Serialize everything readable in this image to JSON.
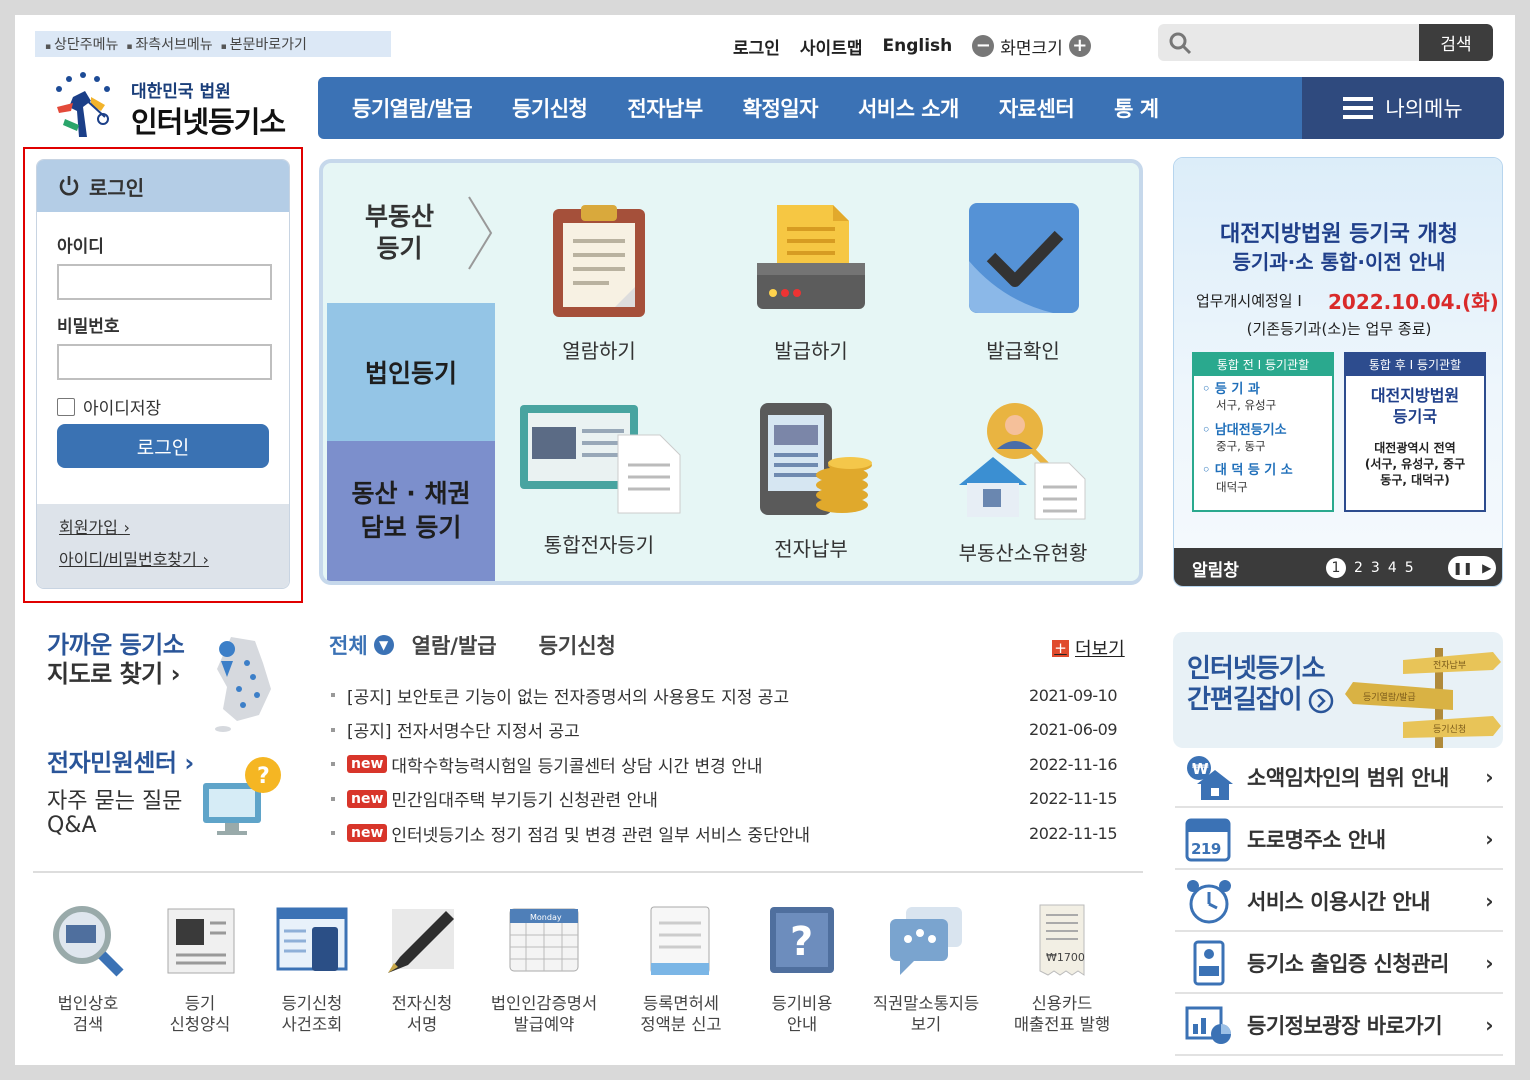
{
  "skip": {
    "items": [
      "상단주메뉴",
      "좌측서브메뉴",
      "본문바로가기"
    ]
  },
  "util": {
    "login": "로그인",
    "sitemap": "사이트맵",
    "english": "English",
    "zoom": "화면크기",
    "zoom_minus": "−",
    "zoom_plus": "+"
  },
  "search": {
    "placeholder": "",
    "button": "검색"
  },
  "logo": {
    "line1": "대한민국 법원",
    "line2": "인터넷등기소"
  },
  "nav": {
    "items": [
      "등기열람/발급",
      "등기신청",
      "전자납부",
      "확정일자",
      "서비스 소개",
      "자료센터",
      "통 계"
    ],
    "my_menu": "나의메뉴"
  },
  "login": {
    "title": "로그인",
    "id_label": "아이디",
    "pw_label": "비밀번호",
    "save_id": "아이디저장",
    "button": "로그인",
    "join": "회원가입",
    "find": "아이디/비밀번호찾기"
  },
  "center": {
    "tabs": [
      "부동산 등기",
      "법인등기",
      "동산 · 채권 담보 등기"
    ],
    "tab_line1": "부동산",
    "tab_line2": "등기",
    "tab3_line1": "동산 · 채권",
    "tab3_line2": "담보 등기",
    "services": [
      "열람하기",
      "발급하기",
      "발급확인",
      "통합전자등기",
      "전자납부",
      "부동산소유현황"
    ]
  },
  "banner": {
    "title1": "대전지방법원 등기국 개청",
    "title2": "등기과·소 통합·이전 안내",
    "date_label": "업무개시예정일 I",
    "date_value": "2022.10.04.(화)",
    "note": "(기존등기과(소)는 업무 종료)",
    "before_head": "통합 전 I 등기관할",
    "before": [
      {
        "name": "등 기 과",
        "area": "서구, 유성구"
      },
      {
        "name": "남대전등기소",
        "area": "중구, 동구"
      },
      {
        "name": "대 덕 등 기 소",
        "area": "대덕구"
      }
    ],
    "after_head": "통합 후 I 등기관할",
    "after_name1": "대전지방법원",
    "after_name2": "등기국",
    "after_area1": "대전광역시 전역",
    "after_area2": "(서구, 유성구, 중구",
    "after_area3": "동구, 대덕구)",
    "bar_label": "알림창",
    "pages": [
      "1",
      "2",
      "3",
      "4",
      "5"
    ]
  },
  "left_links": {
    "map1": "가까운 등기소",
    "map2": "지도로 찾기",
    "center": "전자민원센터",
    "faq1": "자주 묻는 질문",
    "faq2": "Q&A"
  },
  "notices": {
    "tabs": [
      "전체",
      "열람/발급",
      "등기신청"
    ],
    "more": "더보기",
    "new_badge": "new",
    "rows": [
      {
        "title": "[공지] 보안토큰 기능이 없는 전자증명서의 사용용도 지정 공고",
        "date": "2021-09-10",
        "new": false
      },
      {
        "title": "[공지] 전자서명수단 지정서 공고",
        "date": "2021-06-09",
        "new": false
      },
      {
        "title": "대학수학능력시험일 등기콜센터 상담 시간 변경 안내",
        "date": "2022-11-16",
        "new": true
      },
      {
        "title": "민간임대주택 부기등기 신청관련 안내",
        "date": "2022-11-15",
        "new": true
      },
      {
        "title": "인터넷등기소 정기 점검 및 변경 관련 일부 서비스 중단안내",
        "date": "2022-11-15",
        "new": true
      }
    ]
  },
  "guide": {
    "line1": "인터넷등기소",
    "line2": "간편길잡이",
    "sign1": "전자납부",
    "sign2": "등기열람/발급",
    "sign3": "등기신청"
  },
  "right_links": [
    "소액임차인의 범위 안내",
    "도로명주소 안내",
    "서비스 이용시간 안내",
    "등기소 출입증 신청관리",
    "등기정보광장 바로가기"
  ],
  "road_sign_number": "219",
  "bottom_icons": [
    {
      "l1": "법인상호",
      "l2": "검색"
    },
    {
      "l1": "등기",
      "l2": "신청양식"
    },
    {
      "l1": "등기신청",
      "l2": "사건조회"
    },
    {
      "l1": "전자신청",
      "l2": "서명"
    },
    {
      "l1": "법인인감증명서",
      "l2": "발급예약"
    },
    {
      "l1": "등록면허세",
      "l2": "정액분 신고"
    },
    {
      "l1": "등기비용",
      "l2": "안내"
    },
    {
      "l1": "직권말소통지등",
      "l2": "보기"
    },
    {
      "l1": "신용카드",
      "l2": "매출전표 발행"
    }
  ],
  "calendar_label": "Monday",
  "receipt_amount": "₩1700",
  "colors": {
    "nav": "#3b72b5",
    "nav_dark": "#2f4a7e",
    "accent_red": "#d8352a",
    "highlight_red": "#e00000"
  }
}
